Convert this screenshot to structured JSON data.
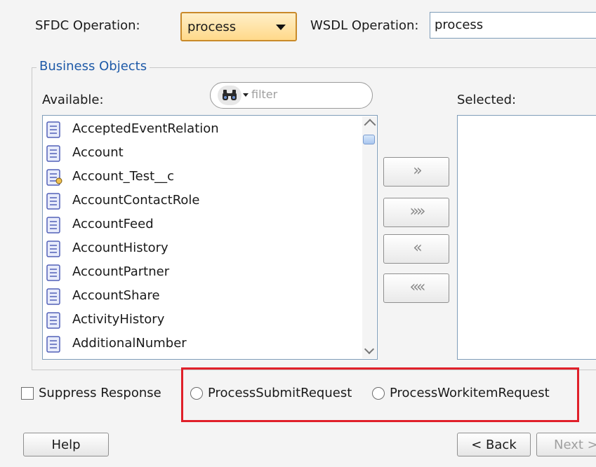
{
  "sfdc": {
    "label": "SFDC Operation:",
    "value": "process"
  },
  "wsdl": {
    "label": "WSDL Operation:",
    "value": "process"
  },
  "group_title": "Business Objects",
  "available": {
    "label": "Available:",
    "filter_placeholder": "filter",
    "items": [
      {
        "label": "AcceptedEventRelation",
        "icon": "object-icon"
      },
      {
        "label": "Account",
        "icon": "object-icon"
      },
      {
        "label": "Account_Test__c",
        "icon": "custom-object-icon"
      },
      {
        "label": "AccountContactRole",
        "icon": "object-icon"
      },
      {
        "label": "AccountFeed",
        "icon": "object-icon"
      },
      {
        "label": "AccountHistory",
        "icon": "object-icon"
      },
      {
        "label": "AccountPartner",
        "icon": "object-icon"
      },
      {
        "label": "AccountShare",
        "icon": "object-icon"
      },
      {
        "label": "ActivityHistory",
        "icon": "object-icon"
      },
      {
        "label": "AdditionalNumber",
        "icon": "object-icon"
      }
    ]
  },
  "selected": {
    "label": "Selected:"
  },
  "shuttle": {
    "add": "»",
    "add_all": "»»",
    "remove": "«",
    "remove_all": "««"
  },
  "suppress_response": "Suppress Response",
  "radio_options": [
    "ProcessSubmitRequest",
    "ProcessWorkitemRequest"
  ],
  "buttons": {
    "help": "Help",
    "back": "< Back",
    "next": "Next >"
  },
  "colors": {
    "highlight": "#e0202a",
    "combo_fill": "#ffd98a",
    "group_title": "#1e5aa8"
  }
}
